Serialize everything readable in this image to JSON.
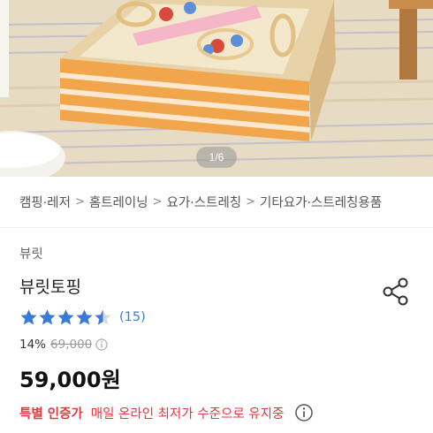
{
  "gallery": {
    "indicator": "1/6"
  },
  "breadcrumb": {
    "items": [
      "캠핑·레저",
      "홈트레이닝",
      "요가·스트레칭",
      "기타요가·스트레칭용품"
    ],
    "separator": ">"
  },
  "product": {
    "brand": "뷰릿",
    "title": "뷰릿토핑",
    "rating": 4.5,
    "review_count": "(15)",
    "discount_rate": "14%",
    "original_price": "69,000",
    "price": "59,000원",
    "badge": "특별 인증가",
    "badge_description": "매일 온라인 최저가 수준으로 유지중"
  },
  "colors": {
    "star": "#3a7bd5",
    "review_link": "#3a7bd5",
    "badge": "#e8383d"
  },
  "icons": {
    "share": "share-icon",
    "info": "info-circle-icon",
    "star": "star-icon"
  }
}
